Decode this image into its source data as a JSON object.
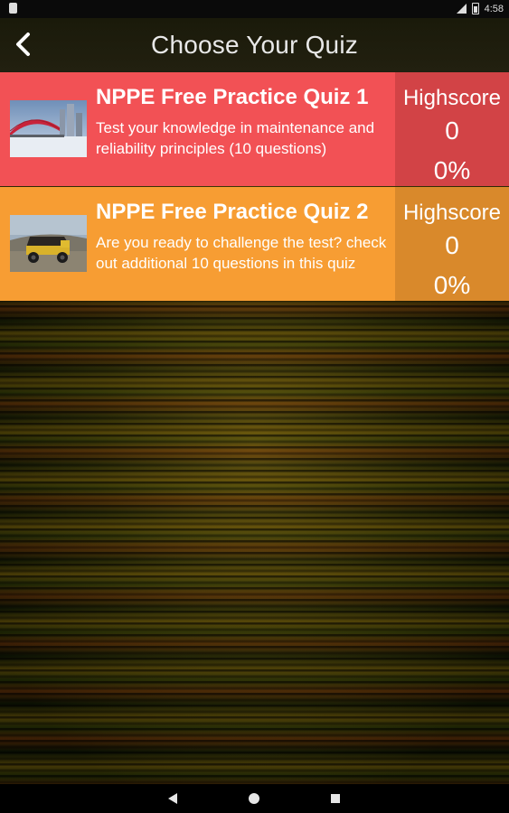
{
  "status_bar": {
    "time": "4:58",
    "icons": [
      "sd-card-icon",
      "signal-icon",
      "battery-icon"
    ]
  },
  "header": {
    "title": "Choose Your Quiz",
    "back_icon": "chevron-left-icon"
  },
  "quizzes": [
    {
      "title": "NPPE Free Practice Quiz 1",
      "description": "Test your knowledge in maintenance and reliability principles (10 questions)",
      "highscore_label": "Highscore",
      "highscore_value": "0",
      "highscore_percent": "0%",
      "color": "#f25155",
      "score_color": "#d24346",
      "thumbnail": "bridge-photo"
    },
    {
      "title": "NPPE Free Practice Quiz 2",
      "description": "Are you ready to challenge the test? check out additional 10 questions in this quiz",
      "highscore_label": "Highscore",
      "highscore_value": "0",
      "highscore_percent": "0%",
      "color": "#f79d33",
      "score_color": "#d9892b",
      "thumbnail": "mining-truck-photo"
    }
  ],
  "nav_bar": {
    "icons": [
      "nav-back-icon",
      "nav-home-icon",
      "nav-recents-icon"
    ]
  }
}
